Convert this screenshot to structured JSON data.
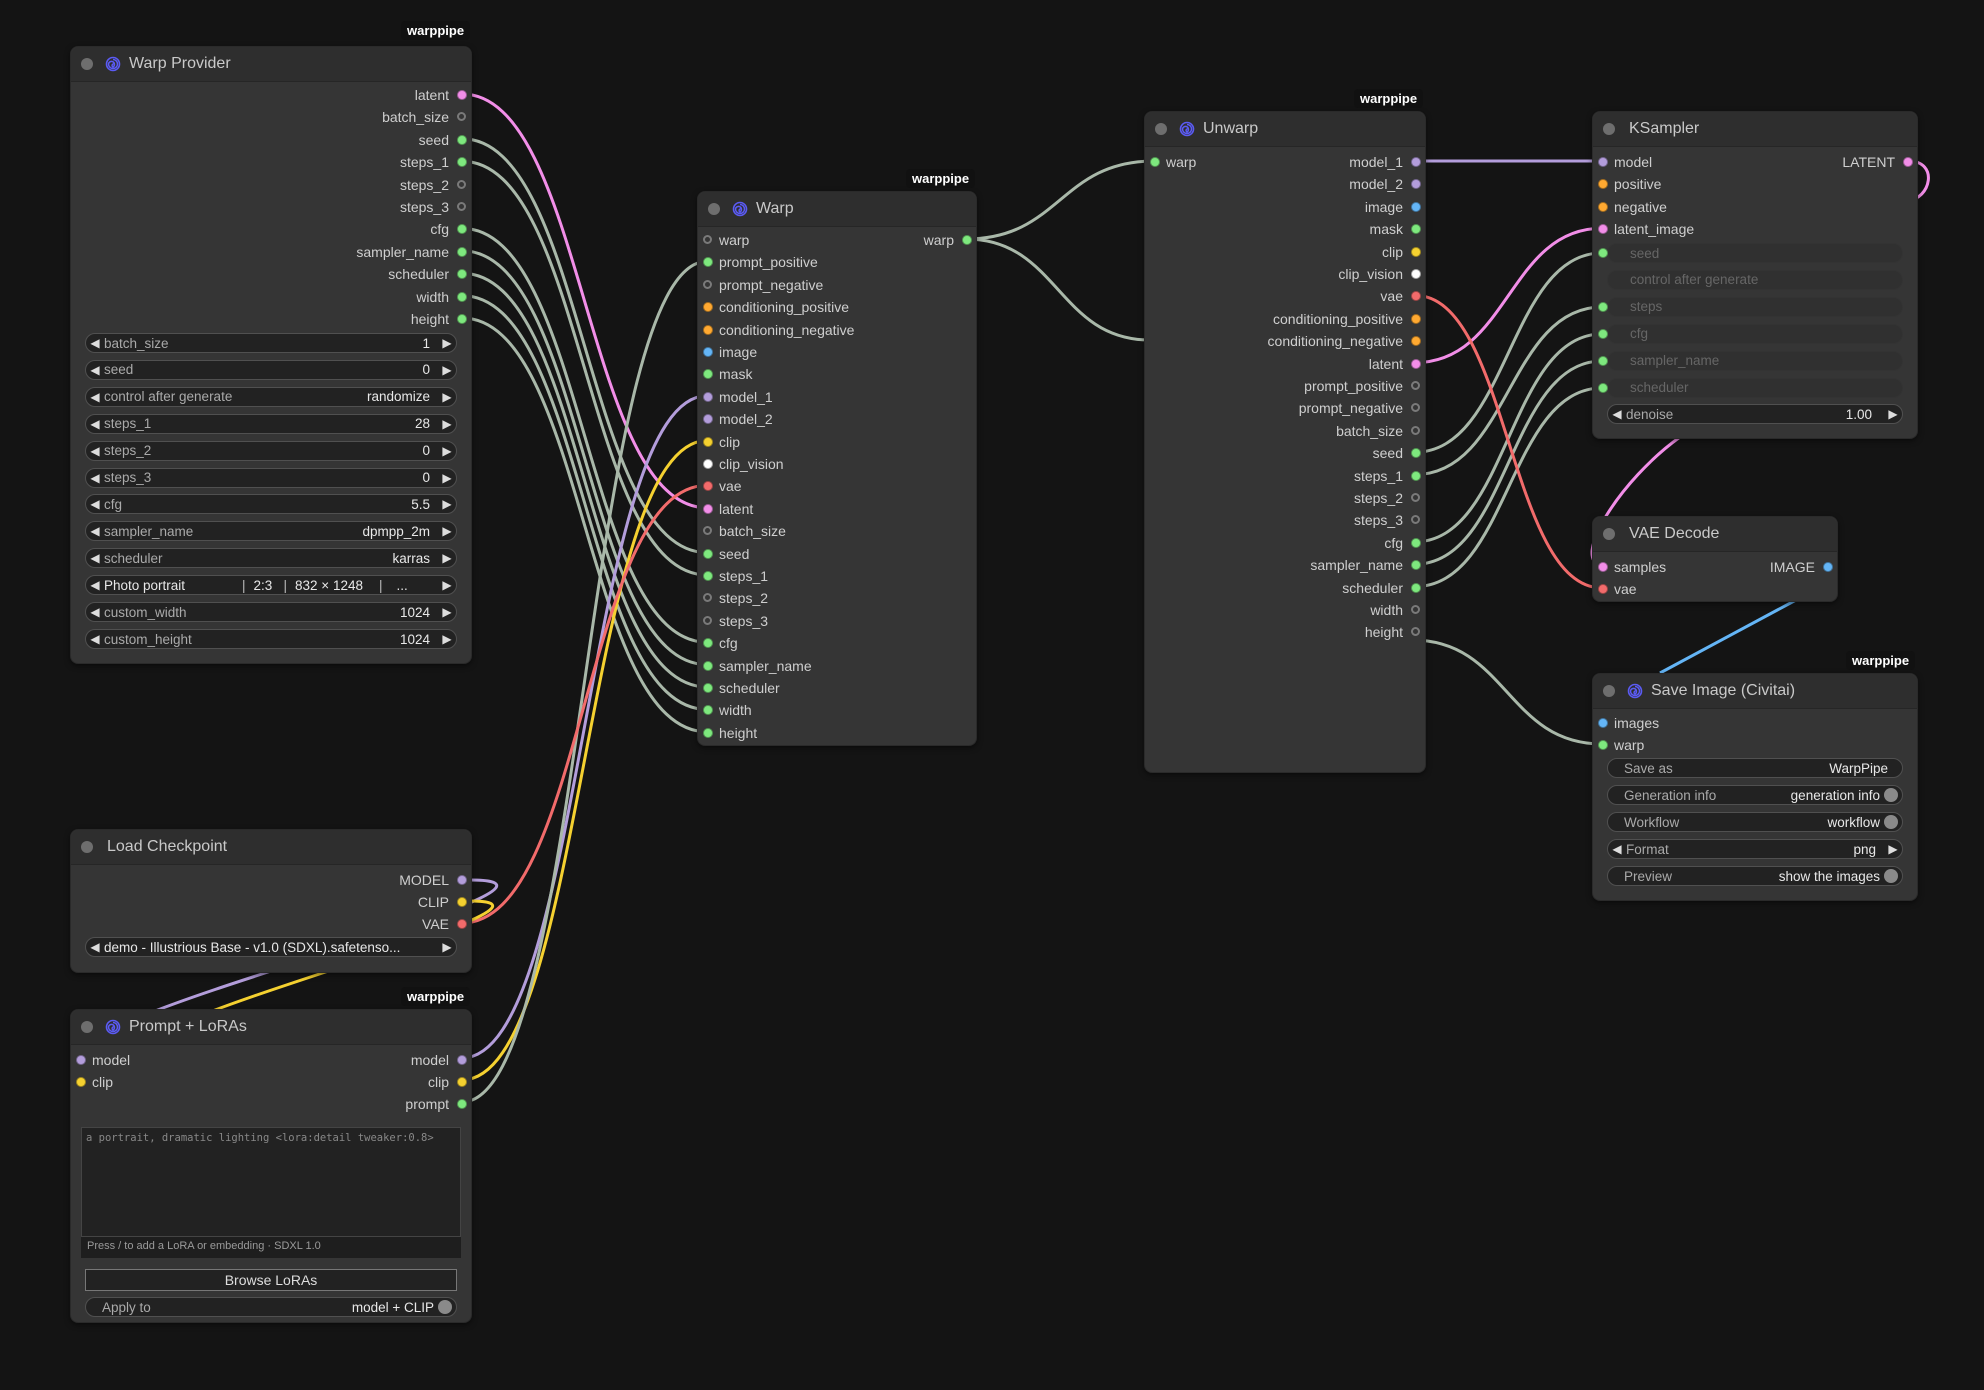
{
  "badge_label": "warppipe",
  "nodes": {
    "warp_provider": {
      "title": "Warp Provider",
      "outputs": [
        "latent",
        "batch_size",
        "seed",
        "steps_1",
        "steps_2",
        "steps_3",
        "cfg",
        "sampler_name",
        "scheduler",
        "width",
        "height"
      ],
      "widgets": [
        {
          "label": "batch_size",
          "value": "1"
        },
        {
          "label": "seed",
          "value": "0"
        },
        {
          "label": "control after generate",
          "value": "randomize"
        },
        {
          "label": "steps_1",
          "value": "28"
        },
        {
          "label": "steps_2",
          "value": "0"
        },
        {
          "label": "steps_3",
          "value": "0"
        },
        {
          "label": "cfg",
          "value": "5.5"
        },
        {
          "label": "sampler_name",
          "value": "dpmpp_2m"
        },
        {
          "label": "scheduler",
          "value": "karras"
        }
      ],
      "preset": {
        "name": "Photo portrait",
        "ratio": "2:3",
        "size": "832 × 1248",
        "more": "..."
      },
      "widgets2": [
        {
          "label": "custom_width",
          "value": "1024"
        },
        {
          "label": "custom_height",
          "value": "1024"
        }
      ]
    },
    "warp": {
      "title": "Warp",
      "inputs": [
        "warp",
        "prompt_positive",
        "prompt_negative",
        "conditioning_positive",
        "conditioning_negative",
        "image",
        "mask",
        "model_1",
        "model_2",
        "clip",
        "clip_vision",
        "vae",
        "latent",
        "batch_size",
        "seed",
        "steps_1",
        "steps_2",
        "steps_3",
        "cfg",
        "sampler_name",
        "scheduler",
        "width",
        "height"
      ],
      "output": "warp"
    },
    "unwarp": {
      "title": "Unwarp",
      "input": "warp",
      "outputs": [
        "model_1",
        "model_2",
        "image",
        "mask",
        "clip",
        "clip_vision",
        "vae",
        "conditioning_positive",
        "conditioning_negative",
        "latent",
        "prompt_positive",
        "prompt_negative",
        "batch_size",
        "seed",
        "steps_1",
        "steps_2",
        "steps_3",
        "cfg",
        "sampler_name",
        "scheduler",
        "width",
        "height"
      ]
    },
    "ksampler": {
      "title": "KSampler",
      "inputs": [
        "model",
        "positive",
        "negative",
        "latent_image"
      ],
      "output": "LATENT",
      "disabled_widgets": [
        "seed",
        "control after generate",
        "steps",
        "cfg",
        "sampler_name",
        "scheduler"
      ],
      "denoise": {
        "label": "denoise",
        "value": "1.00"
      }
    },
    "vae_decode": {
      "title": "VAE Decode",
      "inputs": [
        "samples",
        "vae"
      ],
      "output": "IMAGE"
    },
    "save_image": {
      "title": "Save Image (Civitai)",
      "inputs": [
        "images",
        "warp"
      ],
      "widgets": [
        {
          "label": "Save as",
          "value": "WarpPipe"
        },
        {
          "label": "Generation info",
          "value": "generation info"
        },
        {
          "label": "Workflow",
          "value": "workflow"
        },
        {
          "label": "Format",
          "value": "png"
        },
        {
          "label": "Preview",
          "value": "show the images"
        }
      ]
    },
    "load_checkpoint": {
      "title": "Load Checkpoint",
      "outputs": [
        "MODEL",
        "CLIP",
        "VAE"
      ],
      "ckpt_name": "demo - Illustrious Base - v1.0 (SDXL).safetenso..."
    },
    "prompt_loras": {
      "title": "Prompt + LoRAs",
      "inputs": [
        "model",
        "clip"
      ],
      "outputs": [
        "model",
        "clip",
        "prompt"
      ],
      "prompt_text": "a portrait, dramatic lighting <lora:detail tweaker:0.8>",
      "hint": "Press / to add a LoRA or embedding · SDXL 1.0",
      "browse_label": "Browse LoRAs",
      "apply_to": {
        "label": "Apply to",
        "value": "model + CLIP"
      }
    }
  },
  "colors": {
    "canvas": "#141414",
    "node": "#353535",
    "latent": "#f28ee8",
    "model": "#b39ddb",
    "clip": "#f5d130",
    "vae": "#f26b6b",
    "image": "#64b5f6",
    "int": "#7ee87e",
    "conditioning": "#ffa931",
    "wire_generic": "#a9b8a9",
    "warp_icon": "#5b5bf5"
  }
}
